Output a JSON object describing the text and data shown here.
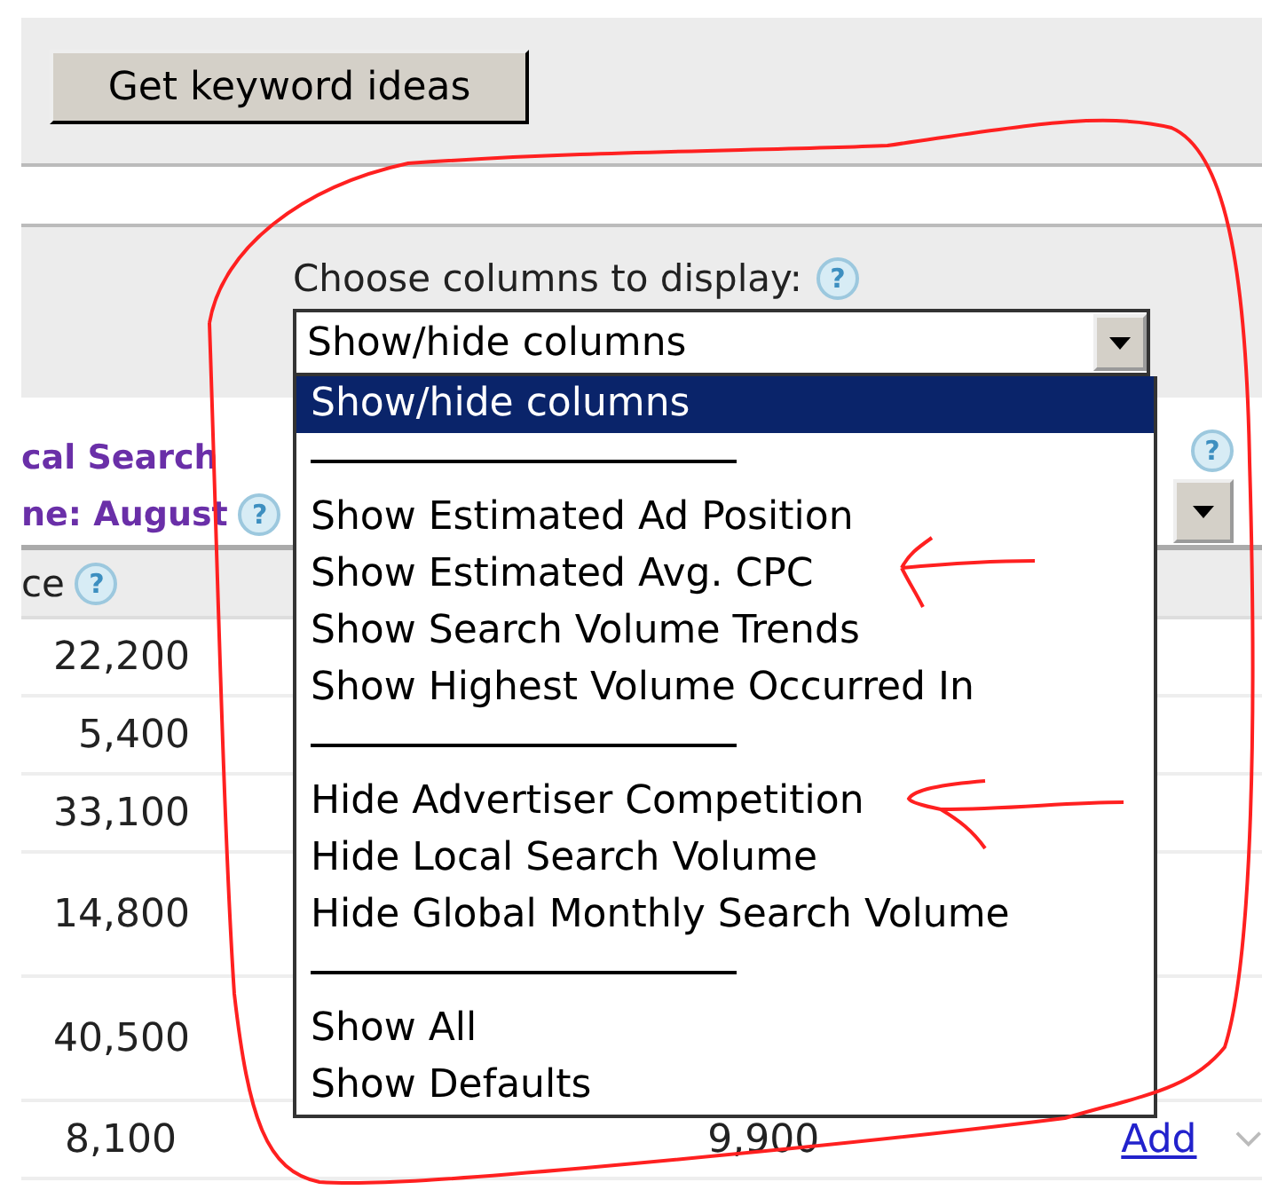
{
  "toolbar": {
    "button": "Get keyword ideas"
  },
  "column_chooser": {
    "label": "Choose columns to display:",
    "help": "?",
    "select_value": "Show/hide columns",
    "expanded": true,
    "options": [
      {
        "kind": "option",
        "label": "Show/hide columns",
        "selected": true
      },
      {
        "kind": "separator"
      },
      {
        "kind": "option",
        "label": "Show Estimated Ad Position",
        "selected": false
      },
      {
        "kind": "option",
        "label": "Show Estimated Avg. CPC",
        "selected": false
      },
      {
        "kind": "option",
        "label": "Show Search Volume Trends",
        "selected": false
      },
      {
        "kind": "option",
        "label": "Show Highest Volume Occurred In",
        "selected": false
      },
      {
        "kind": "separator"
      },
      {
        "kind": "option",
        "label": "Hide Advertiser Competition",
        "selected": false
      },
      {
        "kind": "option",
        "label": "Hide Local Search Volume",
        "selected": false
      },
      {
        "kind": "option",
        "label": "Hide Global Monthly Search Volume",
        "selected": false
      },
      {
        "kind": "separator"
      },
      {
        "kind": "option",
        "label": "Show All",
        "selected": false
      },
      {
        "kind": "option",
        "label": "Show Defaults",
        "selected": false
      }
    ]
  },
  "table": {
    "title_lines": [
      "cal Search",
      "ne: August"
    ],
    "title_help": "?",
    "right_help": "?",
    "column_header": "ce",
    "column_help": "?",
    "rows": [
      {
        "value": "22,200"
      },
      {
        "value": "5,400"
      },
      {
        "value": "33,100"
      },
      {
        "value": "14,800",
        "tall": true
      },
      {
        "value": "40,500",
        "tall": true
      },
      {
        "value": "8,100",
        "column_2": "9,900",
        "action": "Add"
      }
    ]
  }
}
